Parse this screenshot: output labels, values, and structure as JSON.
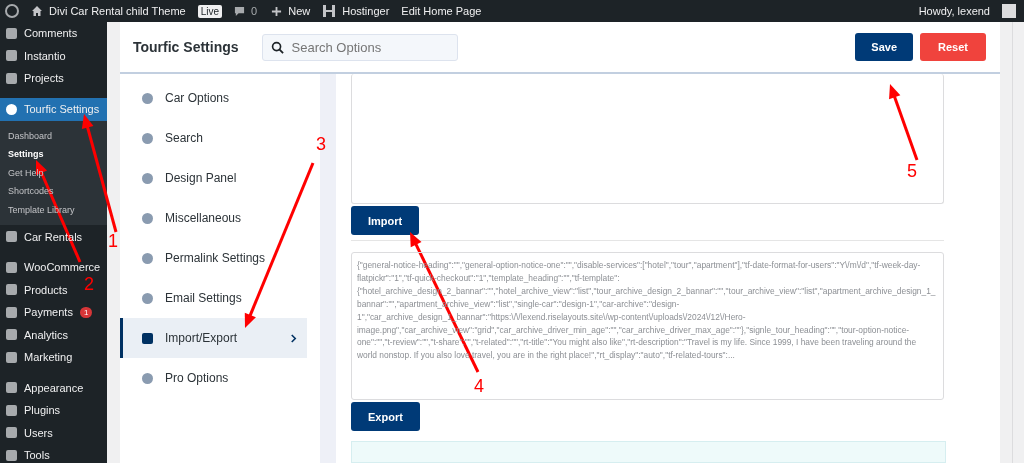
{
  "admin_bar": {
    "site_title": "Divi Car Rental child Theme",
    "live_badge": "Live",
    "comments_count": "0",
    "new_label": "New",
    "hostinger": "Hostinger",
    "edit_page": "Edit Home Page",
    "howdy": "Howdy, lexend"
  },
  "sidebar": {
    "groups": [
      [
        {
          "label": "Comments",
          "selected": false
        },
        {
          "label": "Instantio",
          "selected": false
        },
        {
          "label": "Projects",
          "selected": false
        }
      ],
      [
        {
          "label": "Tourfic Settings",
          "selected": true,
          "children": [
            {
              "label": "Dashboard",
              "selected": false
            },
            {
              "label": "Settings",
              "selected": true
            },
            {
              "label": "Get Help",
              "selected": false
            },
            {
              "label": "Shortcodes",
              "selected": false
            },
            {
              "label": "Template Library",
              "selected": false
            }
          ]
        },
        {
          "label": "Car Rentals",
          "selected": false
        }
      ],
      [
        {
          "label": "WooCommerce",
          "selected": false
        },
        {
          "label": "Products",
          "selected": false
        },
        {
          "label": "Payments",
          "selected": false,
          "badge": "1"
        },
        {
          "label": "Analytics",
          "selected": false
        },
        {
          "label": "Marketing",
          "selected": false
        }
      ],
      [
        {
          "label": "Appearance",
          "selected": false
        },
        {
          "label": "Plugins",
          "selected": false
        },
        {
          "label": "Users",
          "selected": false
        },
        {
          "label": "Tools",
          "selected": false
        }
      ]
    ]
  },
  "settings": {
    "title": "Tourfic Settings",
    "search": {
      "placeholder": "Search Options"
    },
    "save_button": "Save",
    "reset_button": "Reset",
    "nav": [
      {
        "label": "Car Options",
        "selected": false
      },
      {
        "label": "Search",
        "selected": false
      },
      {
        "label": "Design Panel",
        "selected": false
      },
      {
        "label": "Miscellaneous",
        "selected": false
      },
      {
        "label": "Permalink Settings",
        "selected": false
      },
      {
        "label": "Email Settings",
        "selected": false
      },
      {
        "label": "Import/Export",
        "selected": true
      },
      {
        "label": "Pro Options",
        "selected": false
      }
    ],
    "import_button": "Import",
    "export_text": "{\"general-notice-heading\":\"\",\"general-option-notice-one\":\"\",\"disable-services\":[\"hotel\",\"tour\",\"apartment\"],\"tf-date-format-for-users\":\"Y\\/m\\/d\",\"tf-week-day-flatpickr\":\"1\",\"tf-quick-checkout\":\"1\",\"template_heading\":\"\",\"tf-template\":{\"hotel_archive_design_2_bannar\":\"\",\"hotel_archive_view\":\"list\",\"tour_archive_design_2_bannar\":\"\",\"tour_archive_view\":\"list\",\"apartment_archive_design_1_bannar\":\"\",\"apartment_archive_view\":\"list\",\"single-car\":\"design-1\",\"car-archive\":\"design-1\",\"car_archive_design_1_bannar\":\"https:\\/\\/lexend.riselayouts.site\\/wp-content\\/uploads\\/2024\\/12\\/Hero-image.png\",\"car_archive_view\":\"grid\",\"car_archive_driver_min_age\":\"\",\"car_archive_driver_max_age\":\"\"},\"signle_tour_heading\":\"\",\"tour-option-notice-one\":\"\",\"t-review\":\"\",\"t-share\":\"\",\"t-related\":\"\",\"rt-title\":\"You might also like\",\"rt-description\":\"Travel is my life. Since 1999, I have been traveling around the world nonstop. If you also love travel, you are in the right place!\",\"rt_display\":\"auto\",\"tf-related-tours\":...",
    "export_button": "Export"
  },
  "annotations": [
    {
      "label": "1"
    },
    {
      "label": "2"
    },
    {
      "label": "3"
    },
    {
      "label": "4"
    },
    {
      "label": "5"
    }
  ]
}
